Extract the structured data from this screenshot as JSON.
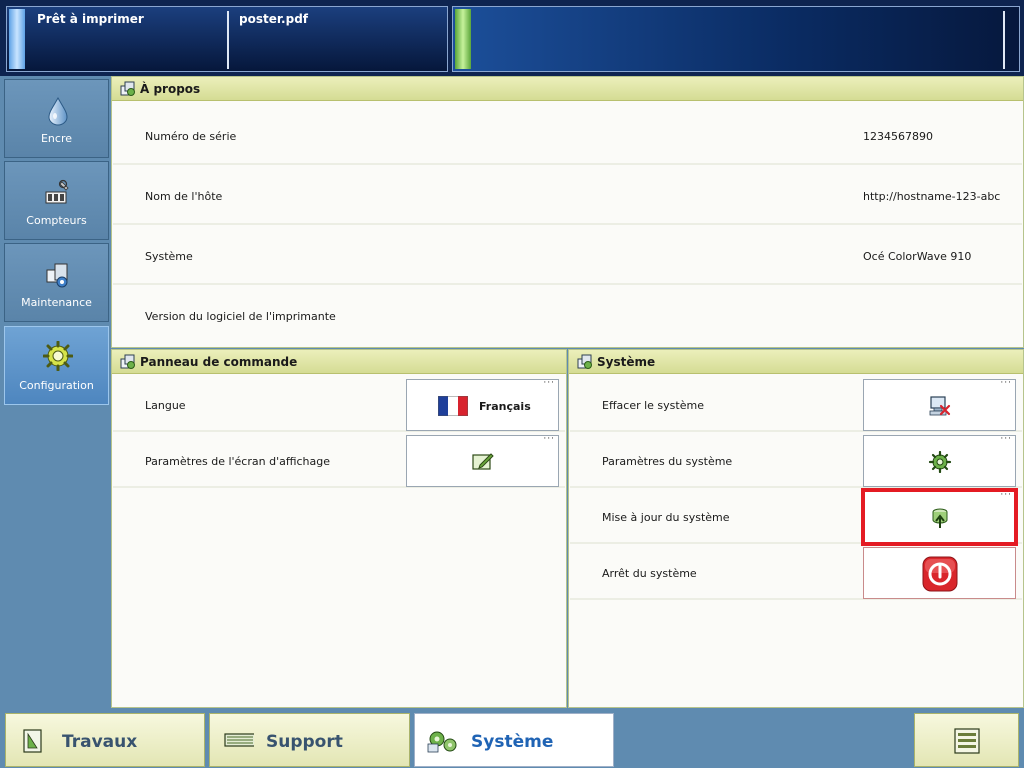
{
  "status": {
    "ready_text": "Prêt à imprimer",
    "job_name": "poster.pdf"
  },
  "leftnav": {
    "items": [
      {
        "label": "Encre",
        "icon": "ink-drop-icon",
        "active": false
      },
      {
        "label": "Compteurs",
        "icon": "counters-icon",
        "active": false
      },
      {
        "label": "Maintenance",
        "icon": "maintenance-icon",
        "active": false
      },
      {
        "label": "Configuration",
        "icon": "gear-icon",
        "active": true
      }
    ]
  },
  "about": {
    "title": "À propos",
    "rows": [
      {
        "label": "Numéro de série",
        "value": "1234567890"
      },
      {
        "label": "Nom de l'hôte",
        "value": "http://hostname-123-abc"
      },
      {
        "label": "Système",
        "value": "Océ ColorWave 910"
      },
      {
        "label": "Version du logiciel de l'imprimante",
        "value": ""
      }
    ]
  },
  "control_panel": {
    "title": "Panneau de commande",
    "rows": [
      {
        "label": "Langue",
        "button_text": "Français",
        "icon": "french-flag-icon"
      },
      {
        "label": "Paramètres de l'écran d'affichage",
        "button_text": "",
        "icon": "edit-display-icon"
      }
    ]
  },
  "system": {
    "title": "Système",
    "rows": [
      {
        "label": "Effacer le système",
        "icon": "clear-system-icon"
      },
      {
        "label": "Paramètres du système",
        "icon": "system-settings-icon"
      },
      {
        "label": "Mise à jour du système",
        "icon": "update-icon"
      },
      {
        "label": "Arrêt du système",
        "icon": "power-icon"
      }
    ]
  },
  "bottom_tabs": [
    {
      "label": "Travaux",
      "icon": "jobs-icon",
      "active": false
    },
    {
      "label": "Support",
      "icon": "media-icon",
      "active": false
    },
    {
      "label": "Système",
      "icon": "system-gears-icon",
      "active": true
    },
    {
      "label": "",
      "icon": "menu-icon",
      "active": false
    }
  ],
  "colors": {
    "highlight": "#e41b23",
    "header_bg": "#d5dc94",
    "nav_bg": "#5f8bb0",
    "shutdown_red": "#d9262b"
  }
}
